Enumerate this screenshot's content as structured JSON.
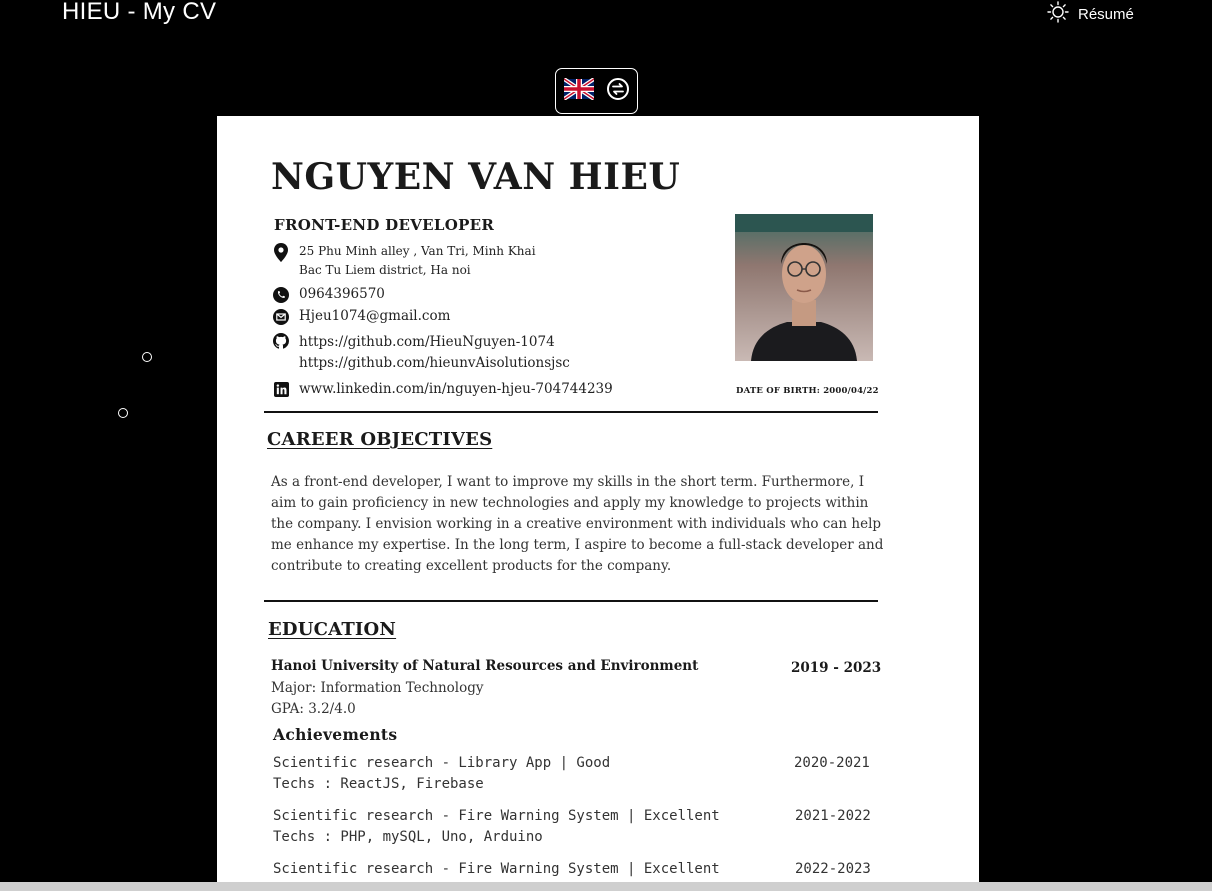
{
  "header": {
    "app_title": "HIEU - My CV",
    "theme_label": "Résumé"
  },
  "icons": {
    "flag": "uk-flag-icon",
    "swap": "swap-language-icon",
    "theme": "sun-icon"
  },
  "cv": {
    "name": "NGUYEN VAN HIEU",
    "role": "FRONT-END DEVELOPER",
    "address_line1": "25 Phu Minh alley , Van Tri, Minh Khai",
    "address_line2": "Bac Tu Liem district, Ha noi",
    "phone": "0964396570",
    "email": "Hjeu1074@gmail.com",
    "github1": "https://github.com/HieuNguyen-1074",
    "github2": "https://github.com/hieunvAisolutionsjsc",
    "linkedin": "www.linkedin.com/in/nguyen-hjeu-704744239",
    "dob": "DATE OF BIRTH: 2000/04/22",
    "career_title": "CAREER OBJECTIVES",
    "career_text": "As a front-end developer, I want to improve my skills in the short term. Furthermore, I aim to gain proficiency in new technologies and apply my knowledge to projects within the company. I envision working in a creative environment with individuals who can help me enhance my expertise. In the long term, I aspire to become a full-stack developer and contribute to creating excellent products for the company.",
    "education_title": "EDUCATION",
    "education": {
      "school": "Hanoi University of Natural Resources and Environment",
      "years": "2019 - 2023",
      "major": "Major: Information Technology",
      "gpa": "GPA: 3.2/4.0"
    },
    "achievements_title": "Achievements",
    "achievements": [
      {
        "title": "Scientific research - Library App | Good",
        "techs": "Techs : ReactJS, Firebase",
        "years": "2020-2021"
      },
      {
        "title": "Scientific research - Fire Warning System | Excellent",
        "techs": "Techs : PHP, mySQL, Uno, Arduino",
        "years": "2021-2022"
      },
      {
        "title": "Scientific research - Fire Warning System | Excellent",
        "techs": "",
        "years": "2022-2023"
      }
    ]
  }
}
